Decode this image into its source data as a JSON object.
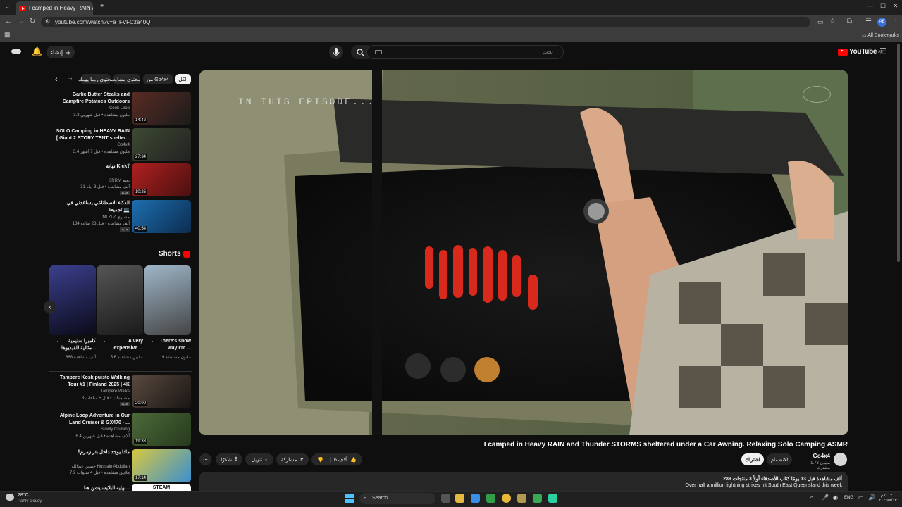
{
  "browser": {
    "tab_title": "I camped in Heavy RAIN and Thunder",
    "url": "youtube.com/watch?v=e_FVFCza40Q",
    "bookmarks_label": "All Bookmarks",
    "profile_initials": "AE"
  },
  "header": {
    "logo_text": "YouTube",
    "region": "AE",
    "search_placeholder": "بحث",
    "create_label": "إنشاء"
  },
  "video": {
    "overlay_text": "IN THIS EPISODE...",
    "title": "I camped in Heavy RAIN and Thunder STORMS sheltered under a Car Awning. Relaxing Solo Camping ASMR",
    "channel": "Go4x4",
    "subscribers": "1.73 مليون مشترك",
    "join_label": "الانضمام",
    "subscribe_label": "اشتراك",
    "likes": "6 آلاف",
    "share_label": "مشاركة",
    "download_label": "تنزيل",
    "thanks_label": "شكرًا"
  },
  "description": {
    "stats": "289 ألف مشاهدة  قبل 13 يومًا  كتاب للأصدقاء أولاً  3 منتجات",
    "text": "Over half a million lightning strikes hit South East Queensland this week"
  },
  "chips": [
    "الكل",
    "من Go4x4",
    "محتوى مشابه",
    "محتوى ربما يهمك"
  ],
  "sidebar_videos": [
    {
      "title": "Garlic Butter Steaks and Campfire Potatoes Outdoors",
      "channel": "Cook Loop",
      "meta": "3.3 مليون مشاهدة • قبل شهرين",
      "duration": "14:42",
      "c1": "#5a2b22",
      "c2": "#1c1c1c"
    },
    {
      "title": "SOLO Camping in HEAVY RAIN [ Giant 2 STORY TENT shelter...",
      "channel": "Go4x4",
      "meta": "3.4 مليون مشاهدة • قبل 7 أشهر",
      "duration": "27:34",
      "c1": "#3d4a32",
      "c2": "#222"
    },
    {
      "title": "نهاية Kick؟",
      "channel": "3RRM نعيم",
      "meta": "31 ألف مشاهدة • قبل 3 أيام",
      "badge": "جديد",
      "duration": "10:26",
      "c1": "#b02020",
      "c2": "#4a1010"
    },
    {
      "title": "الذكاء الاصطناعي يساعدني في تجميعة 💻",
      "channel": "MLZLZ مشاري",
      "meta": "134 ألف مشاهدة • قبل 23 ساعة",
      "badge": "جديد",
      "duration": "40:54",
      "c1": "#1d6fb0",
      "c2": "#0c2c50"
    },
    {
      "title": "Tampere Koskipuisto Walking Tour #1 | Finland 2025 | 4K",
      "channel": "Tampere Walks",
      "meta": "8 مشاهدات • قبل 5 ساعات",
      "badge": "جديد",
      "duration": "20:00",
      "c1": "#5b4a40",
      "c2": "#1a1614"
    },
    {
      "title": "Alpine Loop Adventure in Our Land Cruiser & GX470 - ...",
      "channel": "Slowly Cruising",
      "meta": "8.4 آلاف مشاهدة • قبل شهرين",
      "duration": "19:33",
      "c1": "#4d6a3a",
      "c2": "#263a1c"
    },
    {
      "title": "ماذا يوجد داخل بئر زمزم؟",
      "channel": "حسين عبدالله Hussain Abdullah",
      "meta": "7.2 ملايين مشاهدة • قبل 4 سنوات",
      "duration": "17:14",
      "c1": "#d8c840",
      "c2": "#3a90d0"
    }
  ],
  "shorts": {
    "heading": "Shorts",
    "items": [
      {
        "title": "كاميرا سنيمية مثالية للفيديوها...",
        "views": "868 ألف مشاهدة",
        "c1": "#3b3f8c",
        "c2": "#0a0a18"
      },
      {
        "title": "A very expensive ...",
        "views": "5.6 ملايين مشاهدة",
        "c1": "#555",
        "c2": "#1a1a1a"
      },
      {
        "title": "There's snow way I'm ...",
        "views": "19 مليون مشاهدة",
        "c1": "#9eb6c8",
        "c2": "#444"
      }
    ]
  },
  "last_item_partial": {
    "title": "نهاية البلايستيشن هنا...",
    "thumb_label": "STEAM"
  },
  "taskbar": {
    "weather_temp": "28°C",
    "weather_desc": "Partly cloudy",
    "search_label": "Search",
    "language": "ENG",
    "time": "٥:٠٣ م",
    "date": "٢٠٢٥/٨/١٣"
  },
  "colors": {
    "accent": "#ff0000",
    "bg": "#0f0f0f",
    "surface": "#272727"
  }
}
